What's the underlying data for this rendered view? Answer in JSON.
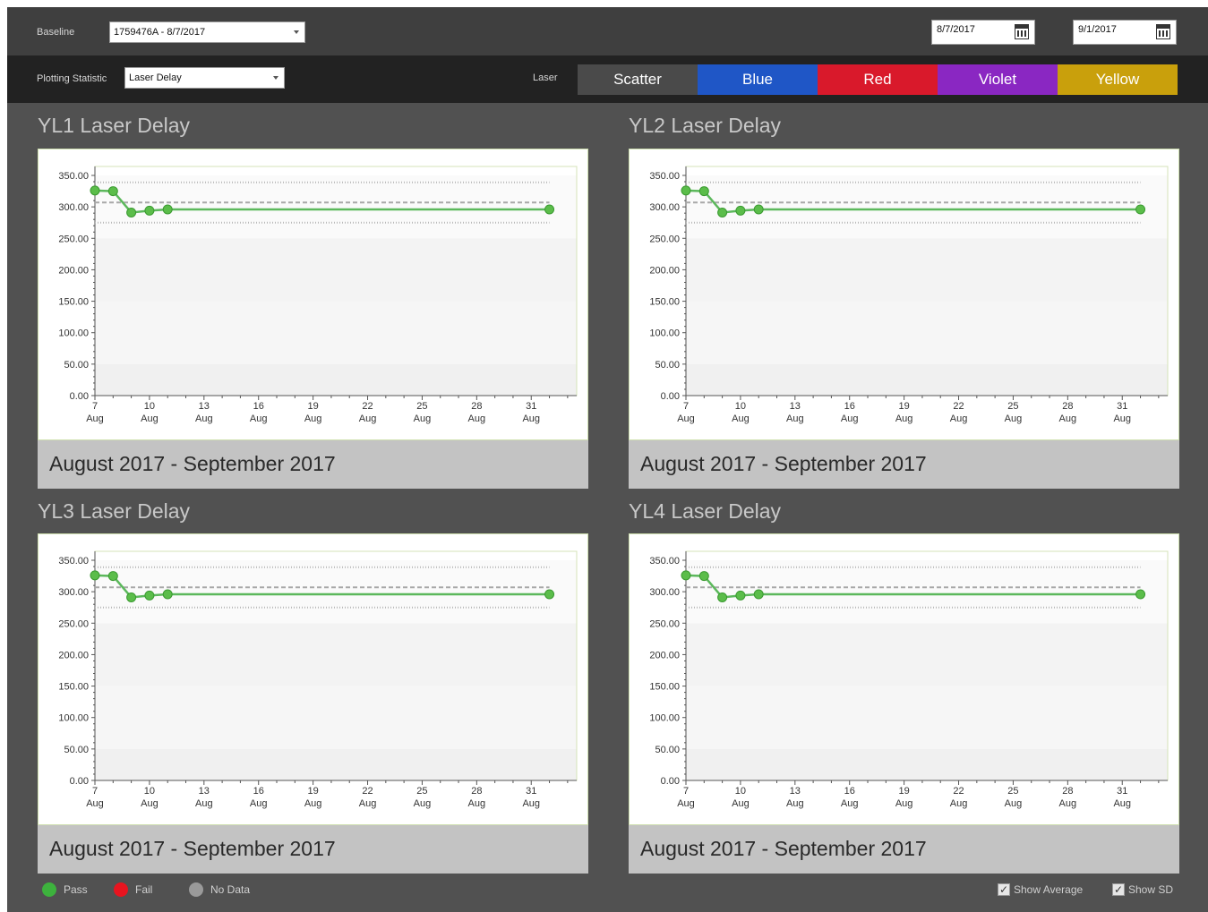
{
  "toolbar": {
    "baseline_label": "Baseline",
    "baseline_value": "1759476A - 8/7/2017",
    "start_date": "8/7/2017",
    "end_date": "9/1/2017"
  },
  "controls": {
    "plotting_statistic_label": "Plotting Statistic",
    "plotting_statistic_value": "Laser Delay",
    "laser_label": "Laser",
    "lasers": [
      {
        "label": "Scatter",
        "color": "#4a4a4a"
      },
      {
        "label": "Blue",
        "color": "#1f56c6"
      },
      {
        "label": "Red",
        "color": "#d9192b"
      },
      {
        "label": "Violet",
        "color": "#8a27c2"
      },
      {
        "label": "Yellow",
        "color": "#c9a00c"
      }
    ]
  },
  "charts": [
    {
      "title": "YL1 Laser Delay",
      "footer": "August 2017 - September 2017"
    },
    {
      "title": "YL2 Laser Delay",
      "footer": "August 2017 - September 2017"
    },
    {
      "title": "YL3 Laser Delay",
      "footer": "August 2017 - September 2017"
    },
    {
      "title": "YL4 Laser Delay",
      "footer": "August 2017 - September 2017"
    }
  ],
  "chart_data": [
    {
      "type": "line",
      "title": "YL1 Laser Delay",
      "x": [
        7,
        8,
        9,
        10,
        11,
        32
      ],
      "values": [
        326,
        325,
        291,
        294,
        296,
        296
      ],
      "xlim": [
        7,
        33.5
      ],
      "ylim": [
        0,
        350
      ],
      "yticks": [
        "0.00",
        "50.00",
        "100.00",
        "150.00",
        "200.00",
        "250.00",
        "300.00",
        "350.00"
      ],
      "xticks": [
        7,
        10,
        13,
        16,
        19,
        22,
        25,
        28,
        31
      ],
      "xtick_month": "Aug",
      "average": 307,
      "sd_upper": 339,
      "sd_lower": 275,
      "color": "#5cb85c"
    },
    {
      "type": "line",
      "title": "YL2 Laser Delay",
      "x": [
        7,
        8,
        9,
        10,
        11,
        32
      ],
      "values": [
        326,
        325,
        291,
        294,
        296,
        296
      ],
      "xlim": [
        7,
        33.5
      ],
      "ylim": [
        0,
        350
      ],
      "yticks": [
        "0.00",
        "50.00",
        "100.00",
        "150.00",
        "200.00",
        "250.00",
        "300.00",
        "350.00"
      ],
      "xticks": [
        7,
        10,
        13,
        16,
        19,
        22,
        25,
        28,
        31
      ],
      "xtick_month": "Aug",
      "average": 307,
      "sd_upper": 339,
      "sd_lower": 275,
      "color": "#5cb85c"
    },
    {
      "type": "line",
      "title": "YL3 Laser Delay",
      "x": [
        7,
        8,
        9,
        10,
        11,
        32
      ],
      "values": [
        326,
        325,
        291,
        294,
        296,
        296
      ],
      "xlim": [
        7,
        33.5
      ],
      "ylim": [
        0,
        350
      ],
      "yticks": [
        "0.00",
        "50.00",
        "100.00",
        "150.00",
        "200.00",
        "250.00",
        "300.00",
        "350.00"
      ],
      "xticks": [
        7,
        10,
        13,
        16,
        19,
        22,
        25,
        28,
        31
      ],
      "xtick_month": "Aug",
      "average": 307,
      "sd_upper": 339,
      "sd_lower": 275,
      "color": "#5cb85c"
    },
    {
      "type": "line",
      "title": "YL4 Laser Delay",
      "x": [
        7,
        8,
        9,
        10,
        11,
        32
      ],
      "values": [
        326,
        325,
        291,
        294,
        296,
        296
      ],
      "xlim": [
        7,
        33.5
      ],
      "ylim": [
        0,
        350
      ],
      "yticks": [
        "0.00",
        "50.00",
        "100.00",
        "150.00",
        "200.00",
        "250.00",
        "300.00",
        "350.00"
      ],
      "xticks": [
        7,
        10,
        13,
        16,
        19,
        22,
        25,
        28,
        31
      ],
      "xtick_month": "Aug",
      "average": 307,
      "sd_upper": 339,
      "sd_lower": 275,
      "color": "#5cb85c"
    }
  ],
  "legend": {
    "items": [
      {
        "label": "Pass",
        "color": "#3db23d"
      },
      {
        "label": "Fail",
        "color": "#e8141f"
      },
      {
        "label": "No Data",
        "color": "#9a9a9a"
      }
    ],
    "show_average_label": "Show Average",
    "show_average_checked": true,
    "show_sd_label": "Show SD",
    "show_sd_checked": true
  }
}
